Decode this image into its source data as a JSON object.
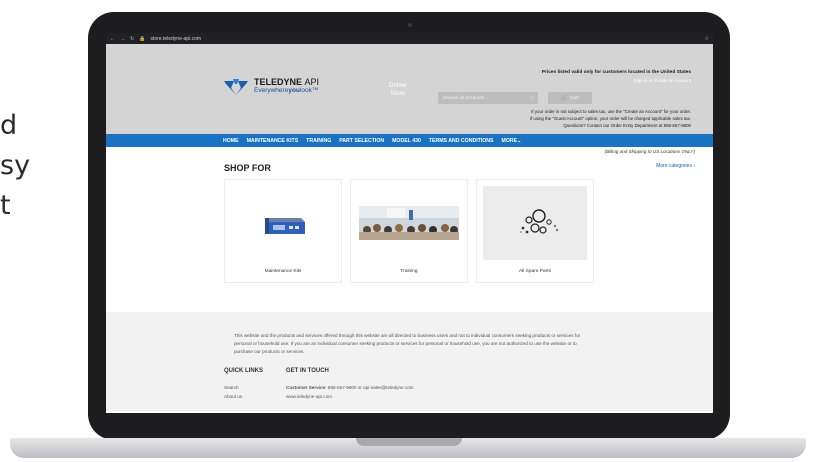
{
  "background_text": [
    "d",
    "sy",
    "t"
  ],
  "browser": {
    "url": "store.teledyne-api.com"
  },
  "header": {
    "brand": "TELEDYNE",
    "brand_suffix": "API",
    "tagline_start": "Everywhere",
    "tagline_bold": "you",
    "tagline_end": "look",
    "online_line1": "Online",
    "online_line2": "Store",
    "prices_notice": "Prices listed valid only for customers located in the United States",
    "sign_in": "Sign in",
    "or": "or",
    "create_account": "Create an Account",
    "search_placeholder": "Search all products...",
    "cart_label": "Cart",
    "note1": "If your order is not subject to sales tax, use the \"Create an Account\" for your order.",
    "note2": "If using the \"Guest Account\" option, your order will be charged applicable sales tax.",
    "note3": "Questions? Contact our Order Entry Department at 858-657-9800"
  },
  "nav": [
    "HOME",
    "MAINTENANCE KITS",
    "TRAINING",
    "PART SELECTION",
    "MODEL 430",
    "TERMS AND CONDITIONS",
    "MORE"
  ],
  "main": {
    "billing": "(Billing and Shipping to US Locations ONLY)",
    "shop_title": "SHOP FOR",
    "more_categories": "More categories ›",
    "cards": [
      "Maintenance Kits",
      "Training",
      "All Spare Parts"
    ]
  },
  "footer": {
    "disclaimer": "This website and the products and services offered through this website are all directed to business users and not to individual consumers seeking products or services for personal or household use. If you are an individual consumer seeking products or services for personal or household use, you are not authorized to use the website or to purchase our products or services.",
    "quick_links_title": "QUICK LINKS",
    "get_in_touch_title": "GET IN TOUCH",
    "links": [
      "Search",
      "About us"
    ],
    "service_label": "Customer Service:",
    "service_value": "858-657-9800 or api-sales@teledyne.com",
    "website": "www.teledyne-api.com"
  },
  "colors": {
    "nav_blue": "#1a73c2",
    "header_gray": "#d4d4d4",
    "brand_blue": "#1b4f9c"
  }
}
